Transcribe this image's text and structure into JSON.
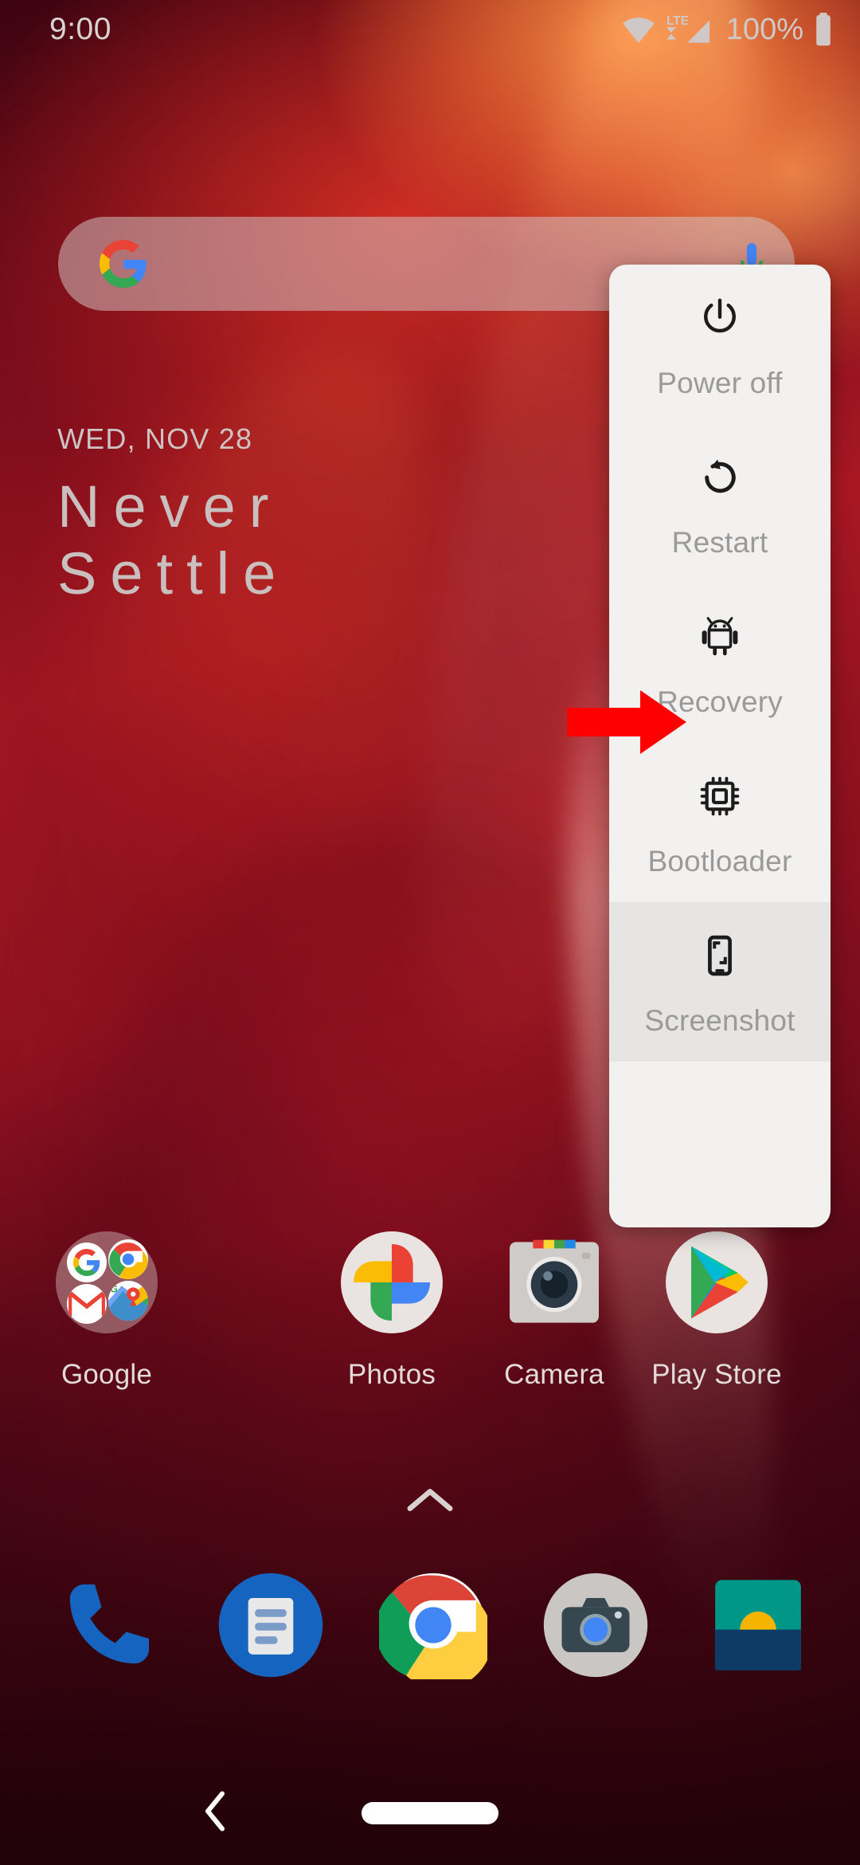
{
  "status_bar": {
    "time": "9:00",
    "battery_text": "100%",
    "network_label": "LTE",
    "icons": [
      "wifi-icon",
      "lte-signal-icon",
      "battery-icon"
    ]
  },
  "search": {
    "placeholder": "",
    "value": "",
    "logo": "google-g-logo",
    "mic_icon": "microphone-icon"
  },
  "widget": {
    "date": "WED, NOV 28",
    "line1": "Never",
    "line2": "Settle"
  },
  "apps": [
    {
      "label": "Google",
      "icon": "google-folder-icon"
    },
    {
      "label": "Photos",
      "icon": "google-photos-icon"
    },
    {
      "label": "Camera",
      "icon": "camera-app-icon"
    },
    {
      "label": "Play Store",
      "icon": "play-store-icon"
    }
  ],
  "drawer": {
    "icon": "chevron-up-icon"
  },
  "dock": [
    {
      "label": "Phone",
      "icon": "phone-icon"
    },
    {
      "label": "Messages",
      "icon": "messages-icon"
    },
    {
      "label": "Chrome",
      "icon": "chrome-icon"
    },
    {
      "label": "Camera",
      "icon": "camera-icon"
    },
    {
      "label": "Gallery",
      "icon": "gallery-icon"
    }
  ],
  "power_menu": {
    "items": [
      {
        "label": "Power off",
        "icon": "power-icon"
      },
      {
        "label": "Restart",
        "icon": "restart-icon"
      },
      {
        "label": "Recovery",
        "icon": "android-robot-icon"
      },
      {
        "label": "Bootloader",
        "icon": "cpu-chip-icon"
      },
      {
        "label": "Screenshot",
        "icon": "screenshot-phone-icon"
      }
    ]
  },
  "annotation": {
    "type": "red-arrow",
    "points_to": "Recovery",
    "color": "#FF0000"
  },
  "nav_bar": {
    "back_icon": "back-chevron-icon",
    "home_icon": "home-pill-icon"
  },
  "colors": {
    "panel_bg": "#f2f1f0",
    "panel_bg_alt": "#e6e5e4",
    "panel_label": "#9a9a9a",
    "annotation_red": "#FF0000",
    "status_text": "#d9d3d2"
  }
}
